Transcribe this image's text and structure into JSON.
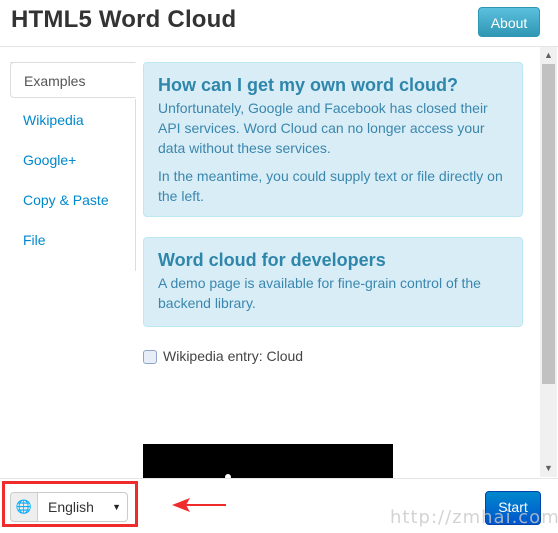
{
  "header": {
    "title": "HTML5 Word Cloud",
    "about_label": "About"
  },
  "sidebar": {
    "items": [
      {
        "label": "Examples",
        "active": true
      },
      {
        "label": "Wikipedia",
        "active": false
      },
      {
        "label": "Google+",
        "active": false
      },
      {
        "label": "Copy & Paste",
        "active": false
      },
      {
        "label": "File",
        "active": false
      }
    ]
  },
  "main": {
    "alert1": {
      "title": "How can I get my own word cloud?",
      "p1": "Unfortunately, Google and Facebook has closed their API services. Word Cloud can no longer access your data without these services.",
      "p2": "In the meantime, you could supply text or file directly on the left."
    },
    "alert2": {
      "title": "Word cloud for developers",
      "p1": "A demo page is available for fine-grain control of the backend library."
    },
    "example_label": "Wikipedia entry: Cloud"
  },
  "footer": {
    "language_value": "English",
    "start_label": "Start"
  },
  "watermark": "http://zmhai.com",
  "colors": {
    "accent": "#0088cc",
    "info_bg": "#d9edf7",
    "highlight": "#ef2b2b"
  },
  "icons": {
    "globe": "globe-icon",
    "caret": "caret-down-icon",
    "arrow": "left-arrow-annotation"
  }
}
